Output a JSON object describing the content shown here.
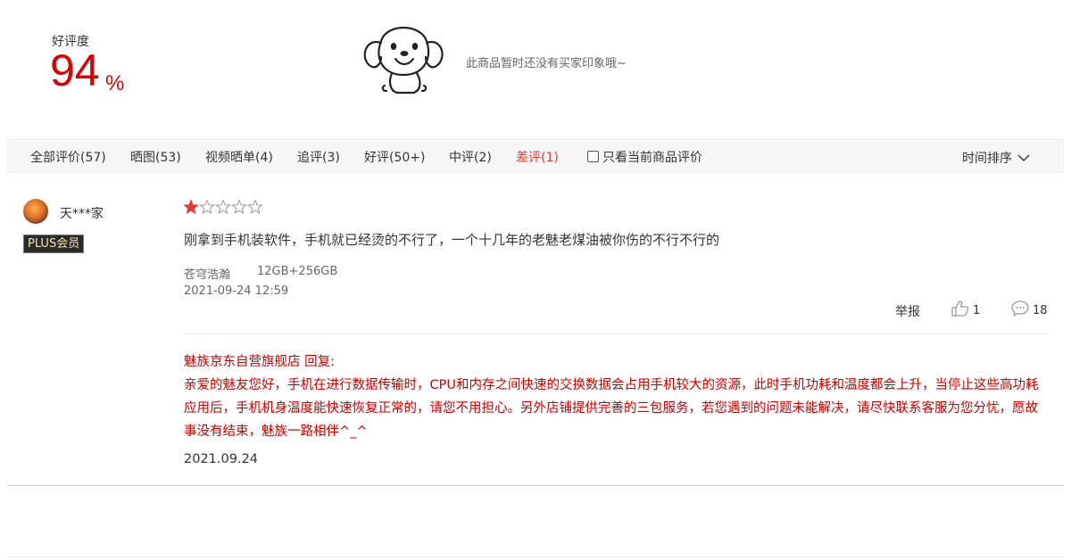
{
  "rating": {
    "label": "好评度",
    "value": "94",
    "unit": "%"
  },
  "empty_message": "此商品暂时还没有买家印象哦~",
  "tabs": [
    {
      "label": "全部评价(57)"
    },
    {
      "label": "晒图(53)"
    },
    {
      "label": "视频晒单(4)"
    },
    {
      "label": "追评(3)"
    },
    {
      "label": "好评(50+)"
    },
    {
      "label": "中评(2)"
    },
    {
      "label": "差评(1)"
    }
  ],
  "filter_current_label": "只看当前商品评价",
  "sort_label": "时间排序",
  "accent_color": "#e4393c",
  "review": {
    "username": "天***家",
    "member_badge": "PLUS会员",
    "stars_total": 5,
    "stars_filled": 1,
    "text": "刚拿到手机装软件，手机就已经烫的不行了，一个十几年的老魅老煤油被你伤的不行不行的",
    "variant": "苍穹浩瀚",
    "spec": "12GB+256GB",
    "time": "2021-09-24 12:59",
    "report_label": "举报",
    "likes": "1",
    "comments": "18",
    "reply": {
      "header": "魅族京东自营旗舰店 回复:",
      "text": "亲爱的魅友您好，手机在进行数据传输时，CPU和内存之间快速的交换数据会占用手机较大的资源，此时手机功耗和温度都会上升，当停止这些高功耗应用后，手机机身温度能快速恢复正常的，请您不用担心。另外店铺提供完善的三包服务，若您遇到的问题未能解决，请尽快联系客服为您分忧，愿故事没有结束，魅族一路相伴^_^",
      "date": "2021.09.24"
    }
  }
}
